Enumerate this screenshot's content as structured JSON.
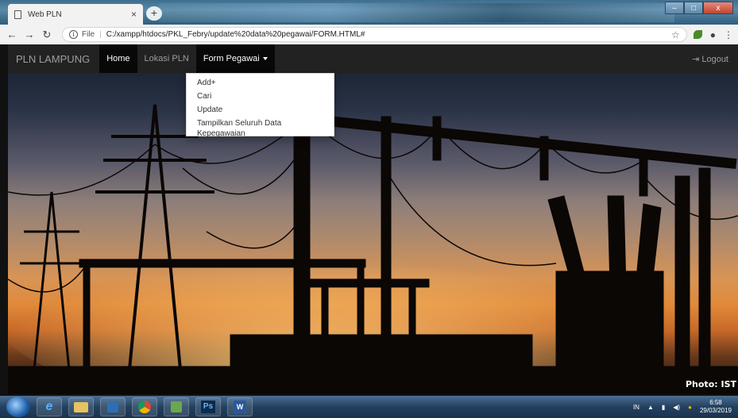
{
  "browser": {
    "tab_title": "Web PLN",
    "tab_close": "×",
    "new_tab": "+",
    "file_label": "File",
    "url": "C:/xampp/htdocs/PKL_Febry/update%20data%20pegawai/FORM.HTML#"
  },
  "navbar": {
    "brand": "PLN LAMPUNG",
    "items": [
      {
        "label": "Home"
      },
      {
        "label": "Lokasi PLN"
      },
      {
        "label": "Form Pegawai"
      }
    ],
    "logout": "Logout"
  },
  "dropdown": {
    "items": [
      {
        "label": "Add+"
      },
      {
        "label": "Cari"
      },
      {
        "label": "Update"
      },
      {
        "label": "Tampilkan Seluruh Data Kepegawaian"
      }
    ]
  },
  "hero": {
    "credit": "Photo: IST"
  },
  "taskbar": {
    "lang": "IN",
    "time": "6:58",
    "date": "29/03/2019"
  }
}
